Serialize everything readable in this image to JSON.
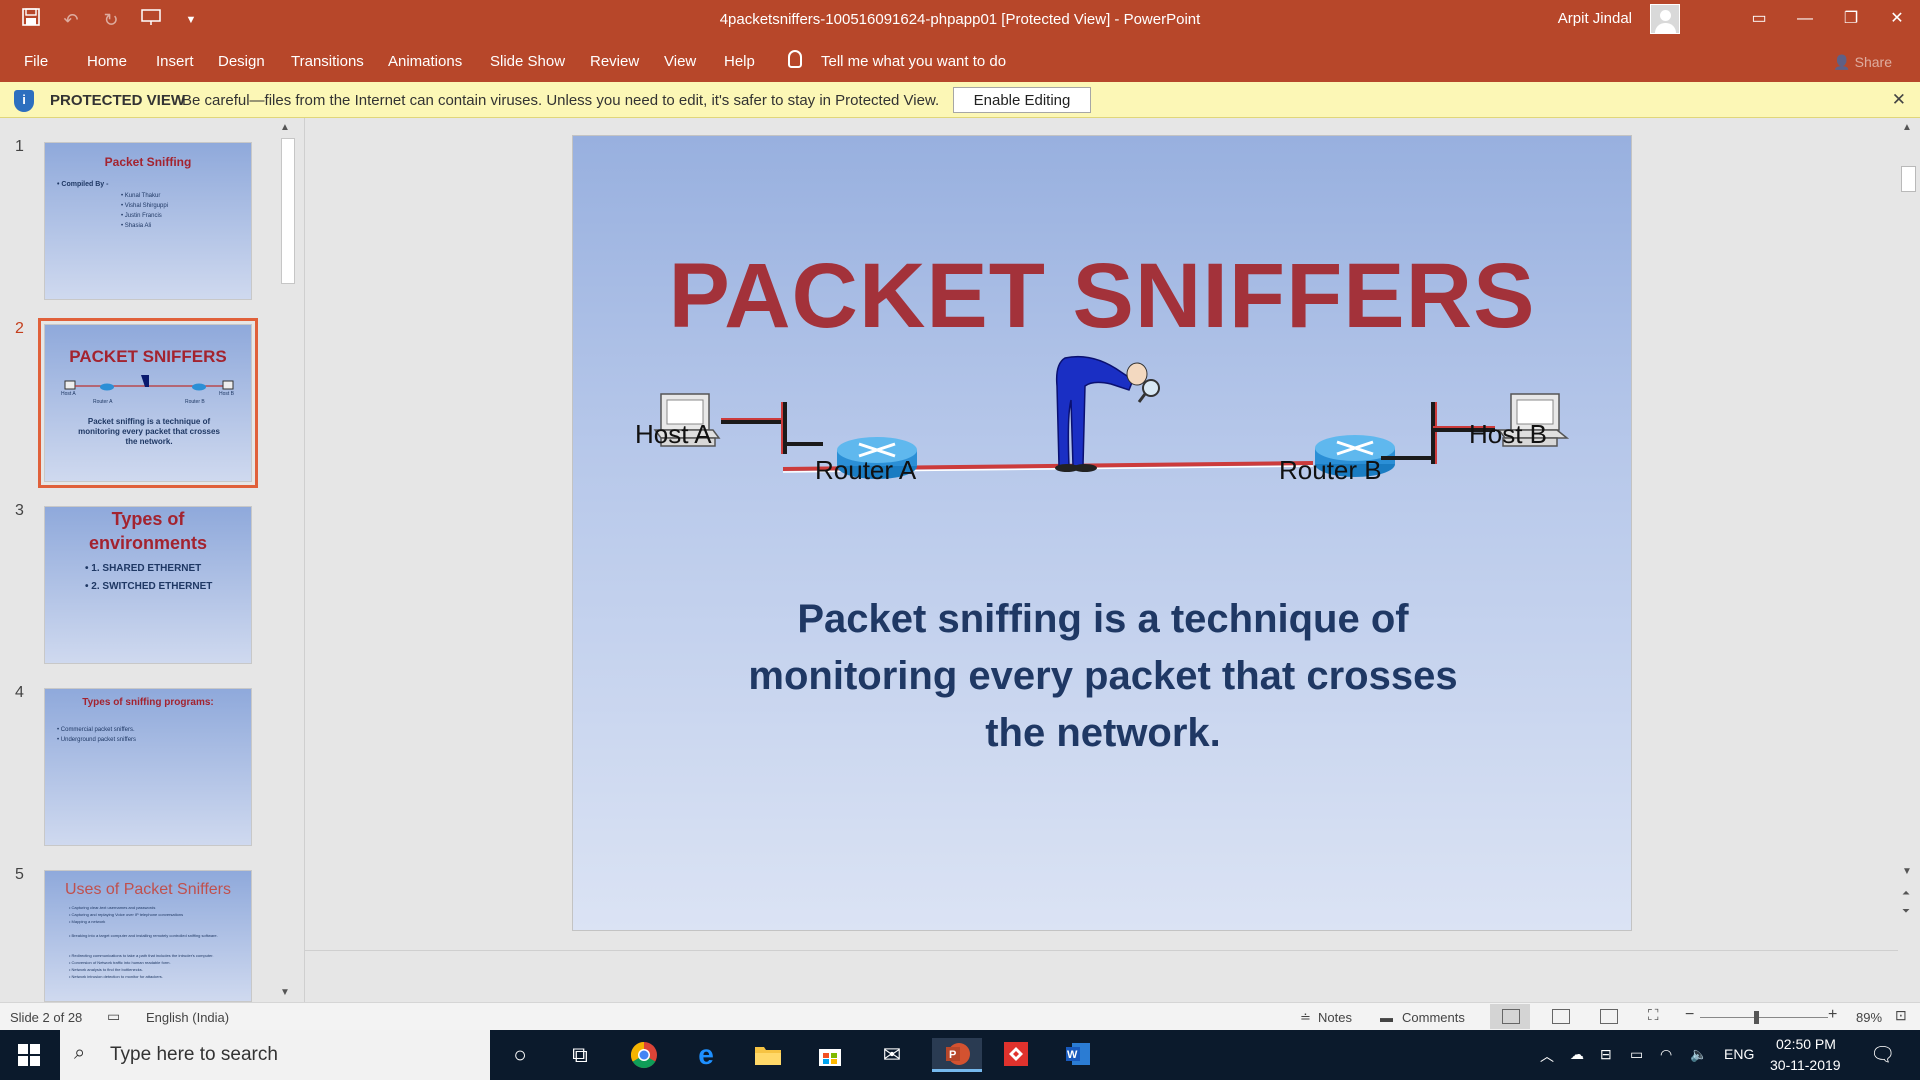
{
  "window": {
    "title": "4packetsniffers-100516091624-phpapp01 [Protected View]  -  PowerPoint",
    "user": "Arpit Jindal"
  },
  "ribbon": {
    "tabs": [
      "File",
      "Home",
      "Insert",
      "Design",
      "Transitions",
      "Animations",
      "Slide Show",
      "Review",
      "View",
      "Help"
    ],
    "tell_me": "Tell me what you want to do",
    "share": "Share"
  },
  "protected": {
    "title": "PROTECTED VIEW",
    "message": "Be careful—files from the Internet can contain viruses. Unless you need to edit, it's safer to stay in Protected View.",
    "button": "Enable Editing"
  },
  "thumbs": [
    {
      "num": "1",
      "title": "Packet Sniffing",
      "lines": [
        "• Compiled By -",
        "• Kunal Thakur",
        "• Vishal Shirguppi",
        "• Justin Francis",
        "• Shasia Ali"
      ]
    },
    {
      "num": "2",
      "title": "PACKET SNIFFERS",
      "text": "Packet sniffing is a technique of monitoring every packet that crosses the network.",
      "labels": [
        "Host A",
        "Router A",
        "Router B",
        "Host B"
      ]
    },
    {
      "num": "3",
      "title": "Types of environments",
      "lines": [
        "• 1. SHARED ETHERNET",
        "• 2. SWITCHED ETHERNET"
      ]
    },
    {
      "num": "4",
      "title": "Types of sniffing programs:",
      "lines": [
        "• Commercial packet sniffers.",
        "• Underground packet sniffers"
      ]
    },
    {
      "num": "5",
      "title": "Uses of Packet Sniffers",
      "lines": [
        "• Capturing clear-text usernames and passwords",
        "• Capturing and replaying Voice over IP telephone conversations",
        "• Mapping a network",
        "• Breaking into a target computer and installing remotely controlled sniffing software.",
        "• Redirecting communications to take a path that includes the intruder's computer.",
        "• Conversion of Network traffic into human readable form.",
        "• Network analysis to find the bottlenecks.",
        "• Network intrusion detection to monitor for attackers."
      ]
    }
  ],
  "slide": {
    "title": "PACKET SNIFFERS",
    "host_a": "Host A",
    "router_a": "Router A",
    "router_b": "Router B",
    "host_b": "Host B",
    "body": "Packet sniffing is a technique of monitoring every packet that crosses the network."
  },
  "status": {
    "slide": "Slide 2 of 28",
    "language": "English (India)",
    "notes": "Notes",
    "comments": "Comments",
    "zoom": "89%"
  },
  "taskbar": {
    "search_placeholder": "Type here to search",
    "lang": "ENG",
    "time": "02:50 PM",
    "date": "30-11-2019"
  }
}
